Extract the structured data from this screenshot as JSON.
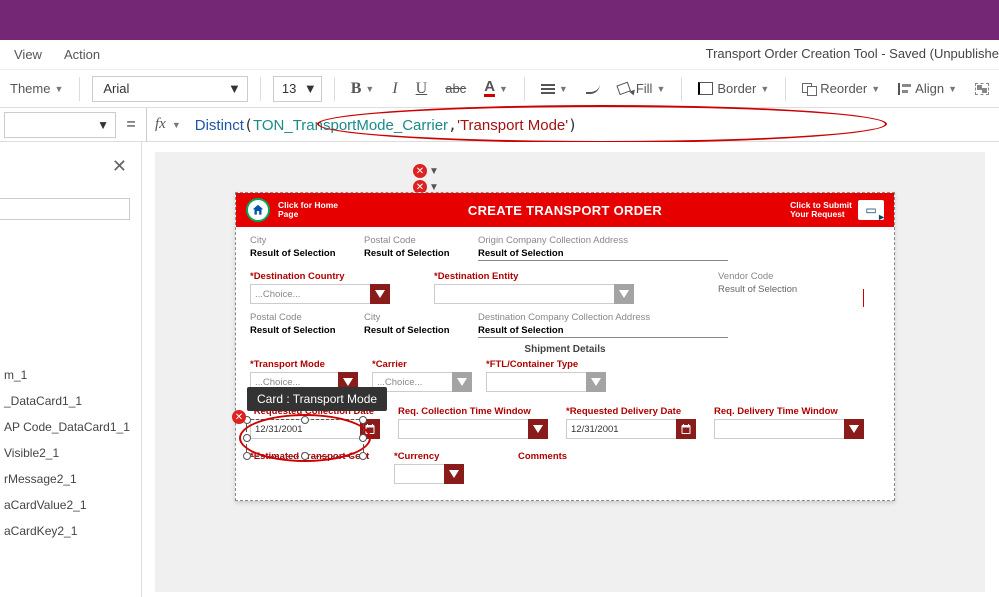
{
  "app": {
    "title_right": "Transport Order Creation Tool - Saved (Unpublishe"
  },
  "menu": {
    "view": "View",
    "action": "Action"
  },
  "toolbar": {
    "theme": "Theme",
    "font": "Arial",
    "size": "13",
    "fill": "Fill",
    "border": "Border",
    "reorder": "Reorder",
    "align": "Align"
  },
  "formula": {
    "fn": "Distinct",
    "ds": "TON_TransportMode_Carrier",
    "arg": "'Transport Mode'"
  },
  "tree": {
    "items": [
      "m_1",
      "_DataCard1_1",
      "AP Code_DataCard1_1",
      "Visible2_1",
      "rMessage2_1",
      "aCardValue2_1",
      "aCardKey2_1"
    ]
  },
  "tooltip": "Card : Transport Mode",
  "header": {
    "home1": "Click for Home",
    "home2": "Page",
    "title": "CREATE TRANSPORT ORDER",
    "submit1": "Click to Submit",
    "submit2": "Your Request"
  },
  "form": {
    "city": "City",
    "postal": "Postal Code",
    "origin_addr": "Origin Company Collection Address",
    "result": "Result of Selection",
    "dest_country": "*Destination Country",
    "dest_entity": "*Destination Entity",
    "vendor": "Vendor Code",
    "dest_addr": "Destination Company Collection Address",
    "choice": "...Choice...",
    "shipment": "Shipment Details",
    "tmode": "*Transport Mode",
    "carrier": "*Carrier",
    "ftl": "*FTL/Container Type",
    "rcd": "*Requested Collection Date",
    "rctw": "Req. Collection Time Window",
    "rdd": "*Requested Delivery Date",
    "rdtw": "Req. Delivery Time Window",
    "date": "12/31/2001",
    "etc": "*Estimated Transport Cost",
    "currency": "*Currency",
    "comments": "Comments"
  }
}
